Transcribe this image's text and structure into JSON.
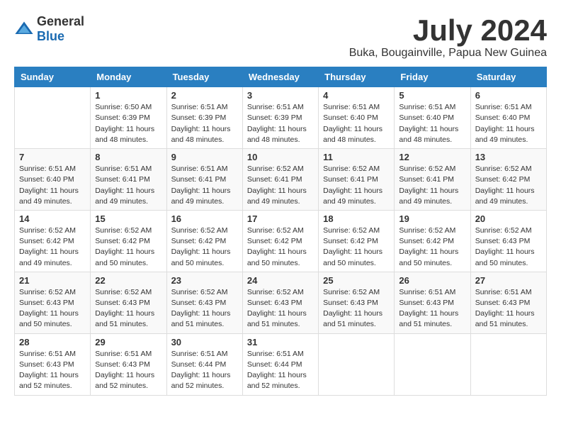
{
  "logo": {
    "general": "General",
    "blue": "Blue"
  },
  "title": {
    "month_year": "July 2024",
    "location": "Buka, Bougainville, Papua New Guinea"
  },
  "days_of_week": [
    "Sunday",
    "Monday",
    "Tuesday",
    "Wednesday",
    "Thursday",
    "Friday",
    "Saturday"
  ],
  "weeks": [
    [
      {
        "day": "",
        "info": ""
      },
      {
        "day": "1",
        "info": "Sunrise: 6:50 AM\nSunset: 6:39 PM\nDaylight: 11 hours\nand 48 minutes."
      },
      {
        "day": "2",
        "info": "Sunrise: 6:51 AM\nSunset: 6:39 PM\nDaylight: 11 hours\nand 48 minutes."
      },
      {
        "day": "3",
        "info": "Sunrise: 6:51 AM\nSunset: 6:39 PM\nDaylight: 11 hours\nand 48 minutes."
      },
      {
        "day": "4",
        "info": "Sunrise: 6:51 AM\nSunset: 6:40 PM\nDaylight: 11 hours\nand 48 minutes."
      },
      {
        "day": "5",
        "info": "Sunrise: 6:51 AM\nSunset: 6:40 PM\nDaylight: 11 hours\nand 48 minutes."
      },
      {
        "day": "6",
        "info": "Sunrise: 6:51 AM\nSunset: 6:40 PM\nDaylight: 11 hours\nand 49 minutes."
      }
    ],
    [
      {
        "day": "7",
        "info": "Sunrise: 6:51 AM\nSunset: 6:40 PM\nDaylight: 11 hours\nand 49 minutes."
      },
      {
        "day": "8",
        "info": "Sunrise: 6:51 AM\nSunset: 6:41 PM\nDaylight: 11 hours\nand 49 minutes."
      },
      {
        "day": "9",
        "info": "Sunrise: 6:51 AM\nSunset: 6:41 PM\nDaylight: 11 hours\nand 49 minutes."
      },
      {
        "day": "10",
        "info": "Sunrise: 6:52 AM\nSunset: 6:41 PM\nDaylight: 11 hours\nand 49 minutes."
      },
      {
        "day": "11",
        "info": "Sunrise: 6:52 AM\nSunset: 6:41 PM\nDaylight: 11 hours\nand 49 minutes."
      },
      {
        "day": "12",
        "info": "Sunrise: 6:52 AM\nSunset: 6:41 PM\nDaylight: 11 hours\nand 49 minutes."
      },
      {
        "day": "13",
        "info": "Sunrise: 6:52 AM\nSunset: 6:42 PM\nDaylight: 11 hours\nand 49 minutes."
      }
    ],
    [
      {
        "day": "14",
        "info": "Sunrise: 6:52 AM\nSunset: 6:42 PM\nDaylight: 11 hours\nand 49 minutes."
      },
      {
        "day": "15",
        "info": "Sunrise: 6:52 AM\nSunset: 6:42 PM\nDaylight: 11 hours\nand 50 minutes."
      },
      {
        "day": "16",
        "info": "Sunrise: 6:52 AM\nSunset: 6:42 PM\nDaylight: 11 hours\nand 50 minutes."
      },
      {
        "day": "17",
        "info": "Sunrise: 6:52 AM\nSunset: 6:42 PM\nDaylight: 11 hours\nand 50 minutes."
      },
      {
        "day": "18",
        "info": "Sunrise: 6:52 AM\nSunset: 6:42 PM\nDaylight: 11 hours\nand 50 minutes."
      },
      {
        "day": "19",
        "info": "Sunrise: 6:52 AM\nSunset: 6:42 PM\nDaylight: 11 hours\nand 50 minutes."
      },
      {
        "day": "20",
        "info": "Sunrise: 6:52 AM\nSunset: 6:43 PM\nDaylight: 11 hours\nand 50 minutes."
      }
    ],
    [
      {
        "day": "21",
        "info": "Sunrise: 6:52 AM\nSunset: 6:43 PM\nDaylight: 11 hours\nand 50 minutes."
      },
      {
        "day": "22",
        "info": "Sunrise: 6:52 AM\nSunset: 6:43 PM\nDaylight: 11 hours\nand 51 minutes."
      },
      {
        "day": "23",
        "info": "Sunrise: 6:52 AM\nSunset: 6:43 PM\nDaylight: 11 hours\nand 51 minutes."
      },
      {
        "day": "24",
        "info": "Sunrise: 6:52 AM\nSunset: 6:43 PM\nDaylight: 11 hours\nand 51 minutes."
      },
      {
        "day": "25",
        "info": "Sunrise: 6:52 AM\nSunset: 6:43 PM\nDaylight: 11 hours\nand 51 minutes."
      },
      {
        "day": "26",
        "info": "Sunrise: 6:51 AM\nSunset: 6:43 PM\nDaylight: 11 hours\nand 51 minutes."
      },
      {
        "day": "27",
        "info": "Sunrise: 6:51 AM\nSunset: 6:43 PM\nDaylight: 11 hours\nand 51 minutes."
      }
    ],
    [
      {
        "day": "28",
        "info": "Sunrise: 6:51 AM\nSunset: 6:43 PM\nDaylight: 11 hours\nand 52 minutes."
      },
      {
        "day": "29",
        "info": "Sunrise: 6:51 AM\nSunset: 6:43 PM\nDaylight: 11 hours\nand 52 minutes."
      },
      {
        "day": "30",
        "info": "Sunrise: 6:51 AM\nSunset: 6:44 PM\nDaylight: 11 hours\nand 52 minutes."
      },
      {
        "day": "31",
        "info": "Sunrise: 6:51 AM\nSunset: 6:44 PM\nDaylight: 11 hours\nand 52 minutes."
      },
      {
        "day": "",
        "info": ""
      },
      {
        "day": "",
        "info": ""
      },
      {
        "day": "",
        "info": ""
      }
    ]
  ]
}
